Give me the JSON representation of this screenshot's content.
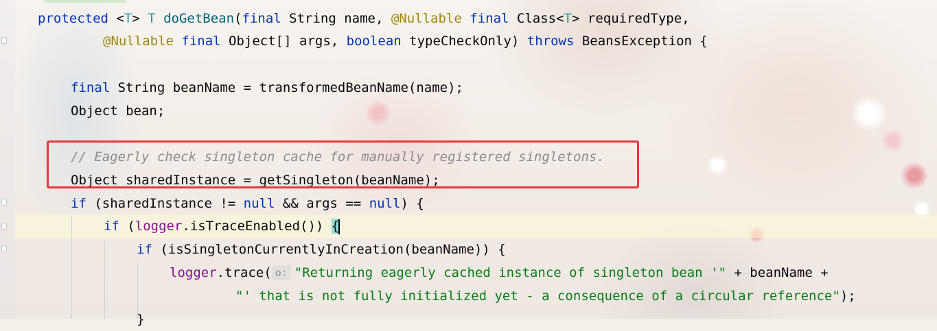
{
  "editor": {
    "language": "java",
    "lines": [
      [
        {
          "t": "kw",
          "v": "protected"
        },
        {
          "t": "",
          "v": " <"
        },
        {
          "t": "tp",
          "v": "T"
        },
        {
          "t": "",
          "v": "> "
        },
        {
          "t": "tp",
          "v": "T"
        },
        {
          "t": "",
          "v": " "
        },
        {
          "t": "fn",
          "v": "doGetBean"
        },
        {
          "t": "",
          "v": "("
        },
        {
          "t": "kw",
          "v": "final"
        },
        {
          "t": "",
          "v": " String name, "
        },
        {
          "t": "ann",
          "v": "@Nullable"
        },
        {
          "t": "",
          "v": " "
        },
        {
          "t": "kw",
          "v": "final"
        },
        {
          "t": "",
          "v": " Class<"
        },
        {
          "t": "tp",
          "v": "T"
        },
        {
          "t": "",
          "v": "> requiredType,"
        }
      ],
      [
        {
          "t": "ann",
          "v": "@Nullable"
        },
        {
          "t": "",
          "v": " "
        },
        {
          "t": "kw",
          "v": "final"
        },
        {
          "t": "",
          "v": " Object[] args, "
        },
        {
          "t": "kw",
          "v": "boolean"
        },
        {
          "t": "",
          "v": " typeCheckOnly) "
        },
        {
          "t": "kw",
          "v": "throws"
        },
        {
          "t": "",
          "v": " BeansException {"
        }
      ],
      [],
      [
        {
          "t": "kw",
          "v": "final"
        },
        {
          "t": "",
          "v": " String beanName = transformedBeanName(name);"
        }
      ],
      [
        {
          "t": "",
          "v": "Object bean;"
        }
      ],
      [],
      [
        {
          "t": "cmt",
          "v": "// Eagerly check singleton cache for manually registered singletons."
        }
      ],
      [
        {
          "t": "",
          "v": "Object sharedInstance = getSingleton(beanName);"
        }
      ],
      [
        {
          "t": "kw",
          "v": "if"
        },
        {
          "t": "",
          "v": " (sharedInstance != "
        },
        {
          "t": "kw",
          "v": "null"
        },
        {
          "t": "",
          "v": " && args == "
        },
        {
          "t": "kw",
          "v": "null"
        },
        {
          "t": "",
          "v": ") {"
        }
      ],
      [
        {
          "t": "kw",
          "v": "if"
        },
        {
          "t": "",
          "v": " ("
        },
        {
          "t": "fld",
          "v": "logger"
        },
        {
          "t": "",
          "v": ".isTraceEnabled()) "
        },
        {
          "t": "brace",
          "v": "{"
        }
      ],
      [
        {
          "t": "kw",
          "v": "if"
        },
        {
          "t": "",
          "v": " (isSingletonCurrentlyInCreation(beanName)) {"
        }
      ],
      [
        {
          "t": "fld",
          "v": "logger"
        },
        {
          "t": "",
          "v": ".trace("
        },
        {
          "t": "hint",
          "v": "o:"
        },
        {
          "t": "str",
          "v": "\"Returning eagerly cached instance of singleton bean '\""
        },
        {
          "t": "",
          "v": " + beanName +"
        }
      ],
      [
        {
          "t": "str",
          "v": "\"' that is not fully initialized yet - a consequence of a circular reference\""
        },
        {
          "t": "",
          "v": ");"
        }
      ],
      [
        {
          "t": "",
          "v": "}"
        }
      ]
    ]
  },
  "colors": {
    "keyword": "#0033b3",
    "annotation": "#9e880d",
    "type_param": "#20999d",
    "method_decl": "#00627a",
    "field": "#871094",
    "string": "#067d17",
    "comment": "#8c8c8c",
    "highlight_box": "#e5383b",
    "brace_match": "#93d9d9",
    "current_line": "#fcf9d6"
  }
}
